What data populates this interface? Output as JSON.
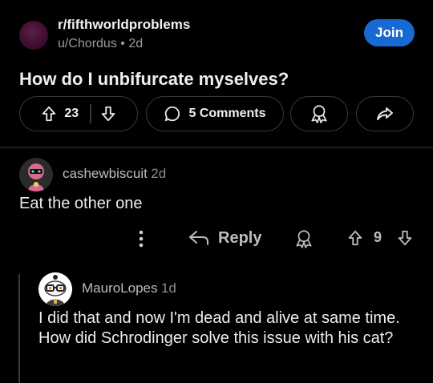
{
  "post": {
    "subreddit": "r/fifthworldproblems",
    "author": "u/Chordus",
    "age": "2d",
    "join_label": "Join",
    "title": "How do I unbifurcate myselves?",
    "votes": "23",
    "comments_label": "5 Comments"
  },
  "comments": [
    {
      "username": "cashewbiscuit",
      "age": "2d",
      "body": "Eat the other one",
      "reply_label": "Reply",
      "votes": "9"
    },
    {
      "username": "MauroLopes",
      "age": "1d",
      "body": "I did that and now I'm dead and alive at same time. How did Schrodinger solve this issue with his cat?"
    }
  ],
  "colors": {
    "background": "#000000",
    "join_button": "#1769d3",
    "pill_border": "#3a3a3a"
  }
}
